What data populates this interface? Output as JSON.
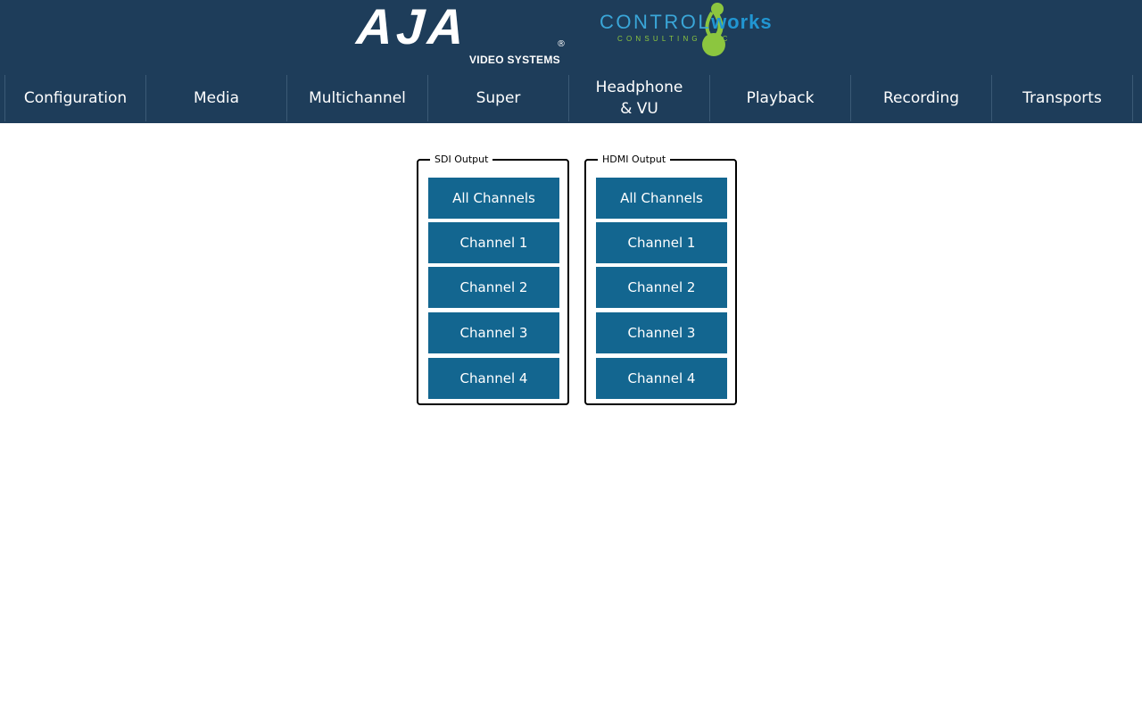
{
  "header": {
    "aja_logo_text": "AJA",
    "aja_registered": "®",
    "aja_tagline": "VIDEO SYSTEMS",
    "cw_logo_prefix": "CONTROL",
    "cw_logo_suffix": "works",
    "cw_logo_tagline": "CONSULTING   LLC"
  },
  "tabs": [
    {
      "label": "Configuration"
    },
    {
      "label": "Media"
    },
    {
      "label": "Multichannel"
    },
    {
      "label": "Super"
    },
    {
      "label": "Headphone\n& VU"
    },
    {
      "label": "Playback"
    },
    {
      "label": "Recording"
    },
    {
      "label": "Transports"
    }
  ],
  "sdi_output": {
    "legend": "SDI Output",
    "buttons": [
      "All Channels",
      "Channel 1",
      "Channel 2",
      "Channel 3",
      "Channel 4"
    ]
  },
  "hdmi_output": {
    "legend": "HDMI Output",
    "buttons": [
      "All Channels",
      "Channel 1",
      "Channel 2",
      "Channel 3",
      "Channel 4"
    ]
  },
  "colors": {
    "header_bg": "#1e3d5a",
    "button_bg": "#136690",
    "cw_blue": "#2196d2",
    "cw_green": "#8cc63f"
  }
}
